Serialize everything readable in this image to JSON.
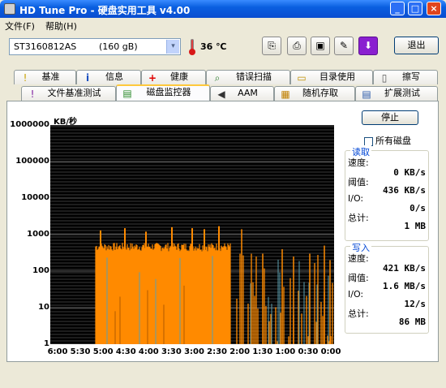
{
  "window": {
    "title": "HD Tune Pro - 硬盘实用工具 v4.00",
    "min": "_",
    "max": "□",
    "close": "×"
  },
  "menu": [
    {
      "label": "文件(F)"
    },
    {
      "label": "帮助(H)"
    }
  ],
  "device": {
    "name": "ST3160812AS",
    "size": "(160 gB)",
    "arrow": "▾"
  },
  "temperature": "36 ℃",
  "toolbar": {
    "exit_label": "退出"
  },
  "tabs_row1": [
    {
      "label": "基准",
      "icon": "!"
    },
    {
      "label": "信息",
      "icon": "i"
    },
    {
      "label": "健康",
      "icon": "+"
    },
    {
      "label": "错误扫描",
      "icon": "⌕"
    },
    {
      "label": "目录使用",
      "icon": "▭"
    },
    {
      "label": "擦写",
      "icon": "▯"
    }
  ],
  "tabs_row2": [
    {
      "label": "文件基准测试",
      "icon": "!"
    },
    {
      "label": "磁盘监控器",
      "icon": "▤"
    },
    {
      "label": "AAM",
      "icon": "◀"
    },
    {
      "label": "随机存取",
      "icon": "▦"
    },
    {
      "label": "扩展测试",
      "icon": "▤"
    }
  ],
  "graph": {
    "y_unit": "KB/秒",
    "y_labels": [
      "1000000",
      "100000",
      "10000",
      "1000",
      "100",
      "10",
      "1"
    ],
    "x_labels": [
      "6:00",
      "5:30",
      "5:00",
      "4:30",
      "4:00",
      "3:30",
      "3:00",
      "2:30",
      "2:00",
      "1:30",
      "1:00",
      "0:30",
      "0:00"
    ]
  },
  "controls": {
    "stop_label": "停止",
    "all_disks_label": "所有磁盘"
  },
  "read": {
    "title": "读取",
    "speed_label": "速度:",
    "speed_value": "0 KB/s",
    "threshold_label": "阈值:",
    "threshold_value": "436 KB/s",
    "io_label": "I/O:",
    "io_value": "0/s",
    "total_label": "总计:",
    "total_value": "1 MB"
  },
  "write": {
    "title": "写入",
    "speed_label": "速度:",
    "speed_value": "421 KB/s",
    "threshold_label": "阈值:",
    "threshold_value": "1.6 MB/s",
    "io_label": "I/O:",
    "io_value": "12/s",
    "total_label": "总计:",
    "total_value": "86 MB"
  },
  "colors": {
    "write_series": "#FF8A00",
    "read_series": "#5AA0B0",
    "grid": "#3A3A3A",
    "title_bar": "#0A5FE0"
  }
}
